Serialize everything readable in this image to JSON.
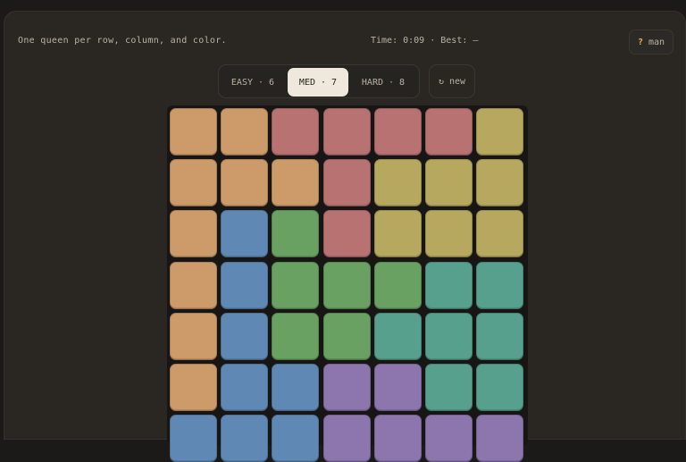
{
  "header": {
    "instructions": "One queen per row, column, and color.",
    "timer": "Time: 0:09 · Best: —",
    "help": {
      "icon": "?",
      "label": "man"
    }
  },
  "difficulty": {
    "options": [
      {
        "label": "EASY · 6",
        "active": false
      },
      {
        "label": "MED · 7",
        "active": true
      },
      {
        "label": "HARD · 8",
        "active": false
      }
    ]
  },
  "new_button": {
    "icon": "↻",
    "label": "new"
  },
  "colors": {
    "orange": "#cd9a6a",
    "red": "#b87272",
    "yellow": "#b6a85f",
    "blue": "#5f89b4",
    "green": "#69a162",
    "teal": "#56a08d",
    "purple": "#8c76ad"
  },
  "board": {
    "size": 7,
    "rows": [
      [
        "orange",
        "orange",
        "red",
        "red",
        "red",
        "red",
        "yellow"
      ],
      [
        "orange",
        "orange",
        "orange",
        "red",
        "yellow",
        "yellow",
        "yellow"
      ],
      [
        "orange",
        "blue",
        "green",
        "red",
        "yellow",
        "yellow",
        "yellow"
      ],
      [
        "orange",
        "blue",
        "green",
        "green",
        "green",
        "teal",
        "teal"
      ],
      [
        "orange",
        "blue",
        "green",
        "green",
        "teal",
        "teal",
        "teal"
      ],
      [
        "orange",
        "blue",
        "blue",
        "purple",
        "purple",
        "teal",
        "teal"
      ],
      [
        "blue",
        "blue",
        "blue",
        "purple",
        "purple",
        "purple",
        "purple"
      ]
    ]
  }
}
